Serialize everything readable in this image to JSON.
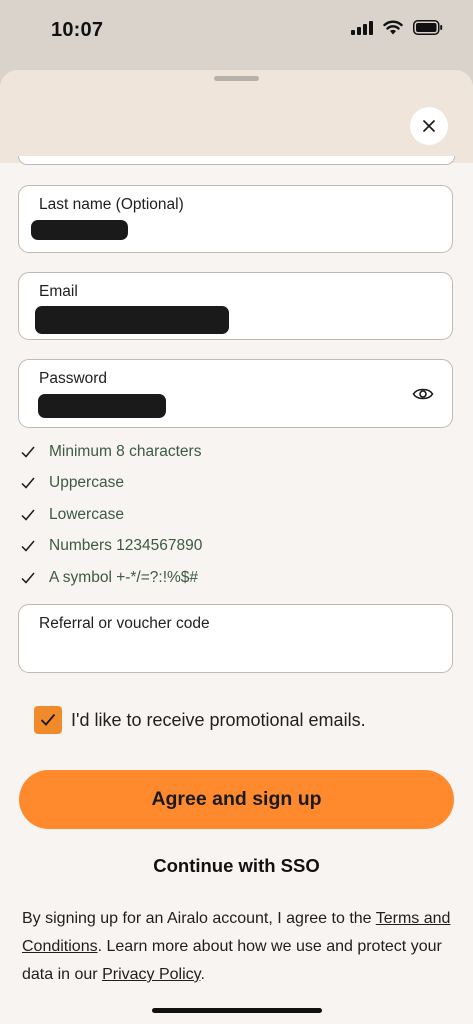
{
  "status_bar": {
    "time": "10:07",
    "icons": [
      "cellular-signal-icon",
      "wifi-icon",
      "battery-icon"
    ]
  },
  "sheet": {
    "close_icon": "close-icon"
  },
  "form": {
    "last_name": {
      "label": "Last name (Optional)"
    },
    "email": {
      "label": "Email"
    },
    "password": {
      "label": "Password",
      "toggle_icon": "eye-icon"
    },
    "requirements": [
      {
        "text": "Minimum 8 characters",
        "met": true
      },
      {
        "text": "Uppercase",
        "met": true
      },
      {
        "text": "Lowercase",
        "met": true
      },
      {
        "text": "Numbers 1234567890",
        "met": true
      },
      {
        "text": "A symbol +-*/=?:!%$#",
        "met": true
      }
    ],
    "referral": {
      "label": "Referral or voucher code"
    },
    "promo": {
      "label": "I'd like to receive promotional emails.",
      "checked": true
    }
  },
  "actions": {
    "primary_label": "Agree and sign up",
    "sso_label": "Continue with SSO"
  },
  "legal": {
    "text_1": "By signing up for an Airalo account, I agree to the ",
    "terms_link": "Terms and Conditions",
    "text_2": ". Learn more about how we use and protect your data in our ",
    "privacy_link": "Privacy Policy",
    "text_3": "."
  },
  "colors": {
    "accent": "#ff8a2e",
    "checkbox": "#f08a2a",
    "requirement_text": "#3c5a44",
    "sheet_background": "#f8f4f1",
    "header_background": "#efe5da"
  }
}
